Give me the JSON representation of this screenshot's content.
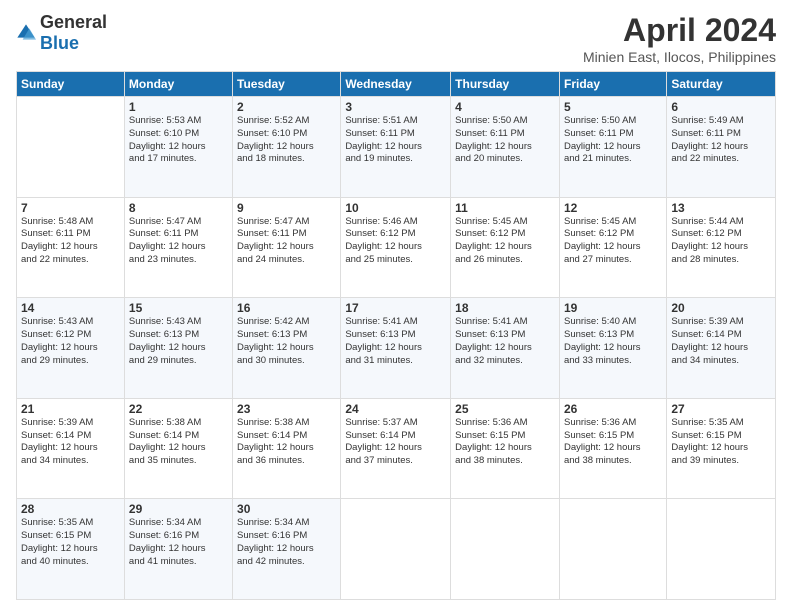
{
  "header": {
    "logo_general": "General",
    "logo_blue": "Blue",
    "month_title": "April 2024",
    "location": "Minien East, Ilocos, Philippines"
  },
  "calendar": {
    "days_of_week": [
      "Sunday",
      "Monday",
      "Tuesday",
      "Wednesday",
      "Thursday",
      "Friday",
      "Saturday"
    ],
    "weeks": [
      [
        {
          "day": "",
          "info": ""
        },
        {
          "day": "1",
          "info": "Sunrise: 5:53 AM\nSunset: 6:10 PM\nDaylight: 12 hours\nand 17 minutes."
        },
        {
          "day": "2",
          "info": "Sunrise: 5:52 AM\nSunset: 6:10 PM\nDaylight: 12 hours\nand 18 minutes."
        },
        {
          "day": "3",
          "info": "Sunrise: 5:51 AM\nSunset: 6:11 PM\nDaylight: 12 hours\nand 19 minutes."
        },
        {
          "day": "4",
          "info": "Sunrise: 5:50 AM\nSunset: 6:11 PM\nDaylight: 12 hours\nand 20 minutes."
        },
        {
          "day": "5",
          "info": "Sunrise: 5:50 AM\nSunset: 6:11 PM\nDaylight: 12 hours\nand 21 minutes."
        },
        {
          "day": "6",
          "info": "Sunrise: 5:49 AM\nSunset: 6:11 PM\nDaylight: 12 hours\nand 22 minutes."
        }
      ],
      [
        {
          "day": "7",
          "info": "Sunrise: 5:48 AM\nSunset: 6:11 PM\nDaylight: 12 hours\nand 22 minutes."
        },
        {
          "day": "8",
          "info": "Sunrise: 5:47 AM\nSunset: 6:11 PM\nDaylight: 12 hours\nand 23 minutes."
        },
        {
          "day": "9",
          "info": "Sunrise: 5:47 AM\nSunset: 6:11 PM\nDaylight: 12 hours\nand 24 minutes."
        },
        {
          "day": "10",
          "info": "Sunrise: 5:46 AM\nSunset: 6:12 PM\nDaylight: 12 hours\nand 25 minutes."
        },
        {
          "day": "11",
          "info": "Sunrise: 5:45 AM\nSunset: 6:12 PM\nDaylight: 12 hours\nand 26 minutes."
        },
        {
          "day": "12",
          "info": "Sunrise: 5:45 AM\nSunset: 6:12 PM\nDaylight: 12 hours\nand 27 minutes."
        },
        {
          "day": "13",
          "info": "Sunrise: 5:44 AM\nSunset: 6:12 PM\nDaylight: 12 hours\nand 28 minutes."
        }
      ],
      [
        {
          "day": "14",
          "info": "Sunrise: 5:43 AM\nSunset: 6:12 PM\nDaylight: 12 hours\nand 29 minutes."
        },
        {
          "day": "15",
          "info": "Sunrise: 5:43 AM\nSunset: 6:13 PM\nDaylight: 12 hours\nand 29 minutes."
        },
        {
          "day": "16",
          "info": "Sunrise: 5:42 AM\nSunset: 6:13 PM\nDaylight: 12 hours\nand 30 minutes."
        },
        {
          "day": "17",
          "info": "Sunrise: 5:41 AM\nSunset: 6:13 PM\nDaylight: 12 hours\nand 31 minutes."
        },
        {
          "day": "18",
          "info": "Sunrise: 5:41 AM\nSunset: 6:13 PM\nDaylight: 12 hours\nand 32 minutes."
        },
        {
          "day": "19",
          "info": "Sunrise: 5:40 AM\nSunset: 6:13 PM\nDaylight: 12 hours\nand 33 minutes."
        },
        {
          "day": "20",
          "info": "Sunrise: 5:39 AM\nSunset: 6:14 PM\nDaylight: 12 hours\nand 34 minutes."
        }
      ],
      [
        {
          "day": "21",
          "info": "Sunrise: 5:39 AM\nSunset: 6:14 PM\nDaylight: 12 hours\nand 34 minutes."
        },
        {
          "day": "22",
          "info": "Sunrise: 5:38 AM\nSunset: 6:14 PM\nDaylight: 12 hours\nand 35 minutes."
        },
        {
          "day": "23",
          "info": "Sunrise: 5:38 AM\nSunset: 6:14 PM\nDaylight: 12 hours\nand 36 minutes."
        },
        {
          "day": "24",
          "info": "Sunrise: 5:37 AM\nSunset: 6:14 PM\nDaylight: 12 hours\nand 37 minutes."
        },
        {
          "day": "25",
          "info": "Sunrise: 5:36 AM\nSunset: 6:15 PM\nDaylight: 12 hours\nand 38 minutes."
        },
        {
          "day": "26",
          "info": "Sunrise: 5:36 AM\nSunset: 6:15 PM\nDaylight: 12 hours\nand 38 minutes."
        },
        {
          "day": "27",
          "info": "Sunrise: 5:35 AM\nSunset: 6:15 PM\nDaylight: 12 hours\nand 39 minutes."
        }
      ],
      [
        {
          "day": "28",
          "info": "Sunrise: 5:35 AM\nSunset: 6:15 PM\nDaylight: 12 hours\nand 40 minutes."
        },
        {
          "day": "29",
          "info": "Sunrise: 5:34 AM\nSunset: 6:16 PM\nDaylight: 12 hours\nand 41 minutes."
        },
        {
          "day": "30",
          "info": "Sunrise: 5:34 AM\nSunset: 6:16 PM\nDaylight: 12 hours\nand 42 minutes."
        },
        {
          "day": "",
          "info": ""
        },
        {
          "day": "",
          "info": ""
        },
        {
          "day": "",
          "info": ""
        },
        {
          "day": "",
          "info": ""
        }
      ]
    ]
  }
}
